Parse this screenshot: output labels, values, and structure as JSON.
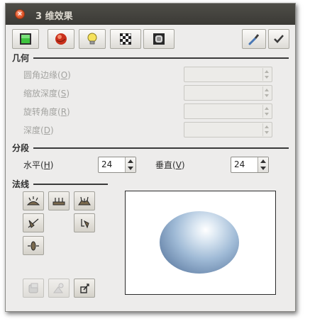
{
  "window": {
    "title": "3 维效果",
    "close_glyph": "×"
  },
  "toolbar": {
    "buttons": [
      {
        "name": "frame-green-icon"
      },
      {
        "name": "sphere-red-icon"
      },
      {
        "name": "lightbulb-icon"
      },
      {
        "name": "checker-icon"
      },
      {
        "name": "rounded-frame-icon"
      }
    ],
    "right_buttons": [
      {
        "name": "color-picker-icon"
      },
      {
        "name": "checkmark-icon"
      }
    ]
  },
  "geometry": {
    "heading": "几何",
    "fields": [
      {
        "label": "圆角边缘(",
        "key": "O",
        "suffix": ")",
        "value": ""
      },
      {
        "label": "缩放深度(",
        "key": "S",
        "suffix": ")",
        "value": ""
      },
      {
        "label": "旋转角度(",
        "key": "R",
        "suffix": ")",
        "value": ""
      },
      {
        "label": "深度(",
        "key": "D",
        "suffix": ")",
        "value": ""
      }
    ]
  },
  "segments": {
    "heading": "分段",
    "horizontal": {
      "label": "水平(",
      "key": "H",
      "suffix": ")",
      "value": "24"
    },
    "vertical": {
      "label": "垂直(",
      "key": "V",
      "suffix": ")",
      "value": "24"
    }
  },
  "normals": {
    "heading": "法线",
    "buttons": [
      {
        "name": "normals-smooth-icon",
        "enabled": true
      },
      {
        "name": "normals-flat-icon",
        "enabled": true
      },
      {
        "name": "normals-mixed-icon",
        "enabled": true
      },
      {
        "name": "normals-invert-icon",
        "enabled": true
      },
      {
        "name": "normals-rotate-icon",
        "enabled": true
      },
      {
        "name": "normals-center-icon",
        "enabled": true
      }
    ],
    "bottom_buttons": [
      {
        "name": "texture-disabled-icon",
        "enabled": false
      },
      {
        "name": "material-disabled-icon",
        "enabled": false
      },
      {
        "name": "wireframe-icon",
        "enabled": true
      }
    ]
  },
  "colors": {
    "titlebar": "#3e3d39",
    "sphere": "#8fb0d2"
  }
}
